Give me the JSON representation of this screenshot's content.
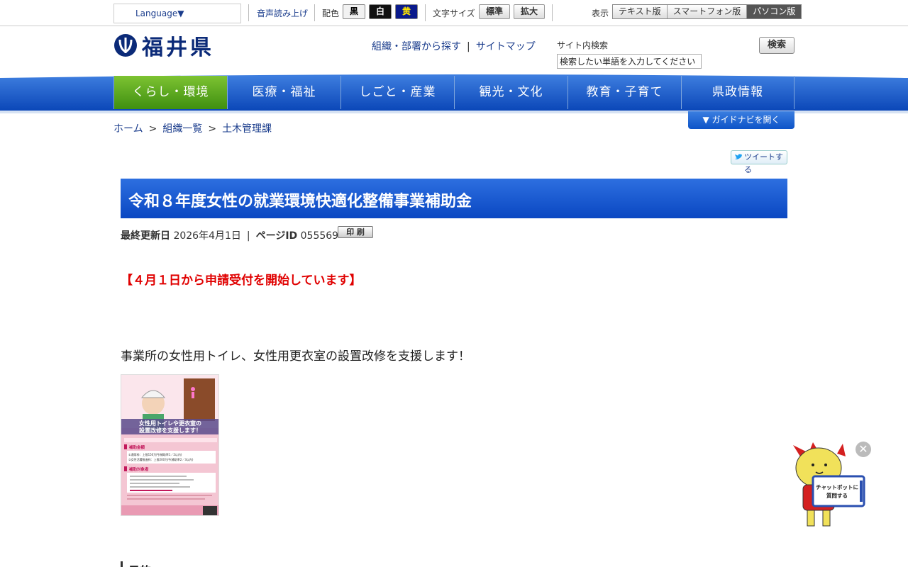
{
  "utility": {
    "language": "Language▼",
    "speech": "音声読み上げ",
    "color_label": "配色",
    "color_black": "黒",
    "color_white": "白",
    "color_yellow": "黄",
    "fontsize_label": "文字サイズ",
    "fontsize_standard": "標準",
    "fontsize_large": "拡大",
    "display_label": "表示",
    "view_text": "テキスト版",
    "view_smartphone": "スマートフォン版",
    "view_pc": "パソコン版"
  },
  "header": {
    "logo_text": "福井県",
    "link_org": "組織・部署から探す",
    "link_sitemap": "サイトマップ",
    "search_label": "サイト内検索",
    "search_placeholder": "検索したい単語を入力してください",
    "search_button": "検索"
  },
  "nav": {
    "items": [
      {
        "label": "くらし・環境"
      },
      {
        "label": "医療・福祉"
      },
      {
        "label": "しごと・産業"
      },
      {
        "label": "観光・文化"
      },
      {
        "label": "教育・子育て"
      },
      {
        "label": "県政情報"
      }
    ]
  },
  "breadcrumb": {
    "home": "ホーム",
    "org_list": "組織一覧",
    "current": "土木管理課"
  },
  "guide_button": "▼ ガイドナビを開く",
  "tweet_button": "ツイートする",
  "page": {
    "title": "令和８年度女性の就業環境快適化整備事業補助金",
    "updated_label": "最終更新日",
    "updated_value": "2026年4月1日",
    "page_id_label": "ページID",
    "page_id_value": "055569",
    "print_button": "印 刷",
    "notice": "【４月１日から申請受付を開始しています】",
    "intro": "事業所の女性用トイレ、女性用更衣室の設置改修を支援します！",
    "section_heading": "目的"
  },
  "flyer": {
    "headline_1": "女性用トイレや更衣室の",
    "headline_2": "設置改修を支援します！",
    "section_1": "補助金額",
    "line_1": "①通常枠：上限150万円(補助率1／2以内)",
    "line_2": "②女性活躍推進枠：上限200万円(補助率2／3以内)",
    "section_2": "補助対象者"
  },
  "chatbot": {
    "bubble_line1": "チャットボットに",
    "bubble_line2": "質問する",
    "close": "✕"
  }
}
